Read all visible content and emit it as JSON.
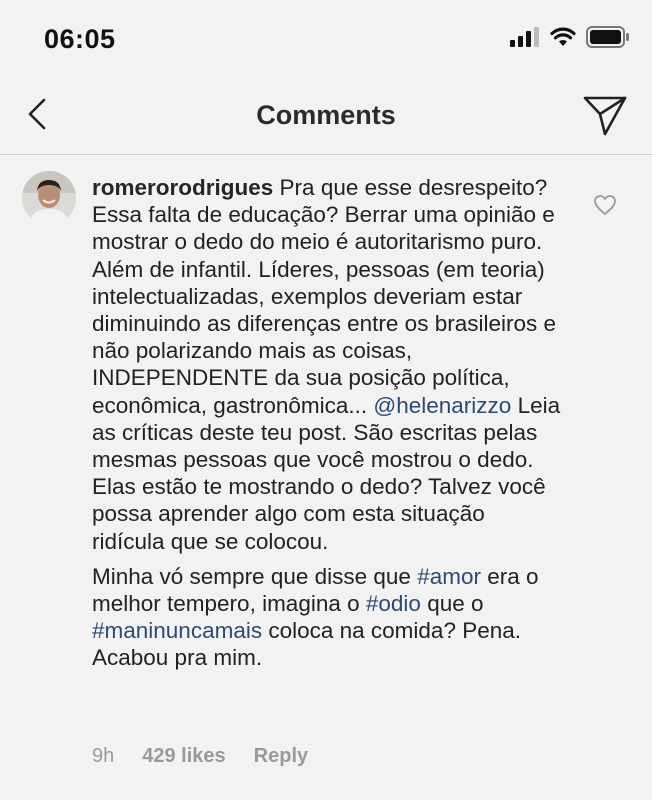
{
  "status_bar": {
    "time": "06:05"
  },
  "nav": {
    "title": "Comments"
  },
  "comment": {
    "username": "romerorodrigues",
    "paragraph1": [
      {
        "type": "text",
        "text": " Pra que esse desrespeito? Essa falta de educação? Berrar uma opinião e mostrar o dedo do meio é autoritarismo puro. Além de infantil. Líderes, pessoas (em teoria) intelectualizadas, exemplos deveriam estar diminuindo as diferenças entre os brasileiros e não polarizando mais as coisas, INDEPENDENTE da sua posição política, econômica, gastronômica... "
      },
      {
        "type": "mention",
        "text": "@helenarizzo"
      },
      {
        "type": "text",
        "text": " Leia as críticas deste teu post. São escritas pelas mesmas pessoas que você mostrou o dedo. Elas estão te mostrando o dedo? Talvez você possa aprender algo com esta situação ridícula que se colocou."
      }
    ],
    "paragraph2": [
      {
        "type": "text",
        "text": "Minha vó sempre que disse que "
      },
      {
        "type": "hashtag",
        "text": "#amor"
      },
      {
        "type": "text",
        "text": " era o melhor tempero, imagina o "
      },
      {
        "type": "hashtag",
        "text": "#odio"
      },
      {
        "type": "text",
        "text": " que o "
      },
      {
        "type": "hashtag",
        "text": "#maninuncamais"
      },
      {
        "type": "text",
        "text": " coloca na comida? Pena. Acabou pra mim."
      }
    ],
    "time_ago": "9h",
    "likes": "429 likes",
    "reply_label": "Reply"
  },
  "icons": {
    "back": "chevron-left-icon",
    "send": "paper-plane-icon",
    "like": "heart-outline-icon",
    "signal": "cellular-signal-icon",
    "wifi": "wifi-icon",
    "battery": "battery-icon"
  },
  "colors": {
    "background": "#f2f2f2",
    "link": "#2d4a72",
    "meta_text": "#9a9a9a"
  }
}
